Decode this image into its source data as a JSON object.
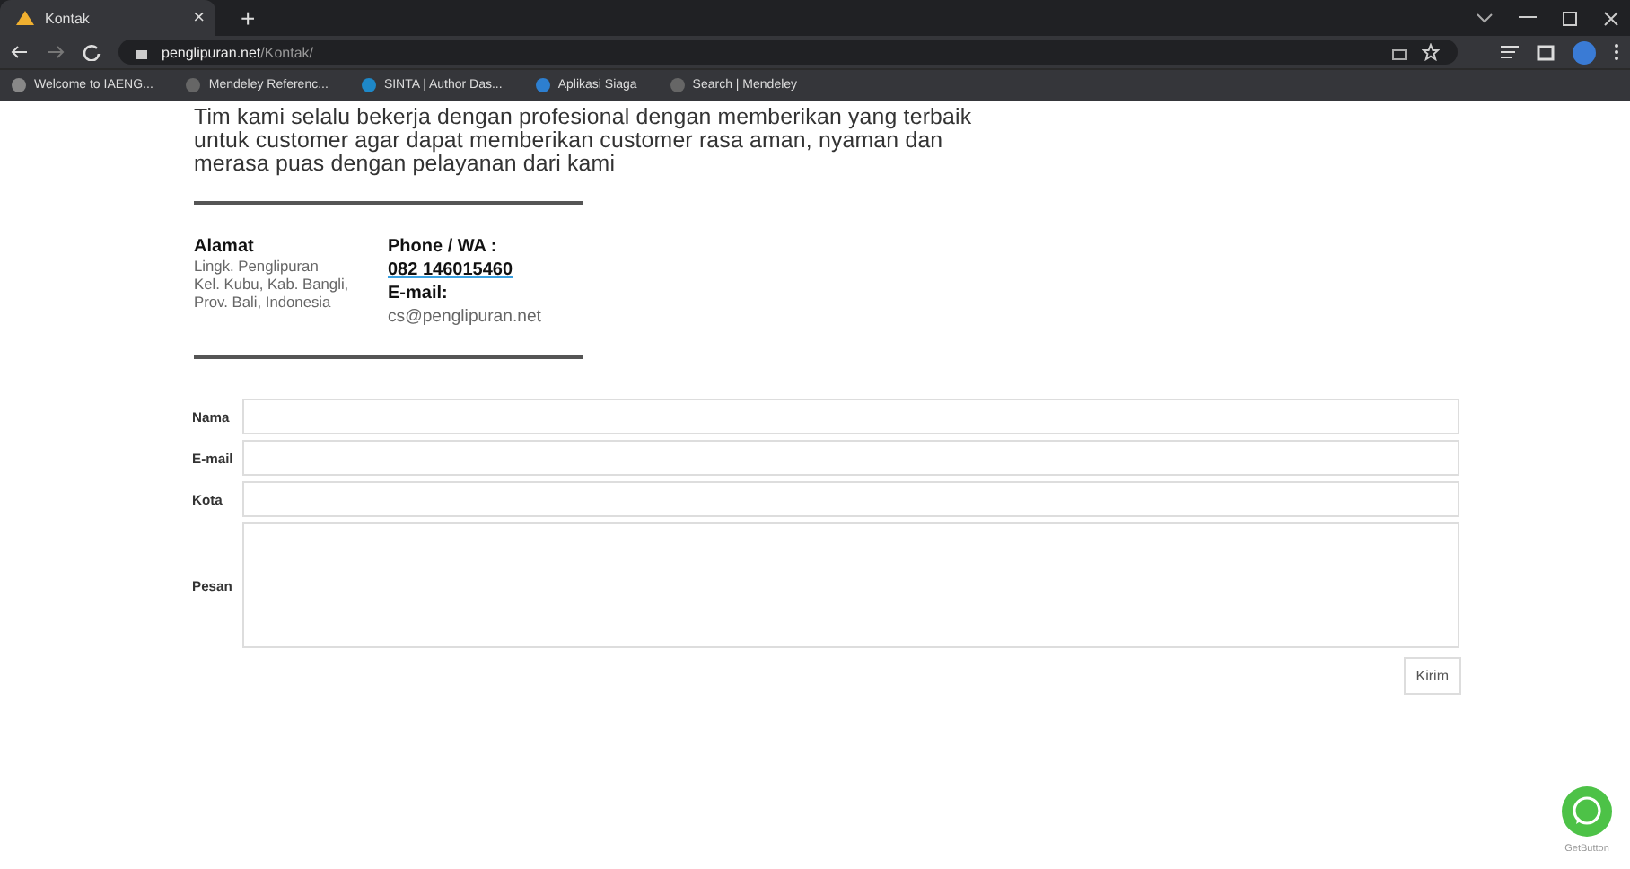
{
  "browser": {
    "tab": {
      "title": "Kontak",
      "close": "×",
      "new_tab": "+"
    },
    "address": {
      "domain": "penglipuran.net",
      "path": "/Kontak/"
    },
    "bookmarks": [
      {
        "label": "Welcome to IAENG..."
      },
      {
        "label": "Mendeley Referenc..."
      },
      {
        "label": "SINTA | Author Das..."
      },
      {
        "label": "Aplikasi Siaga"
      },
      {
        "label": "Search | Mendeley"
      }
    ]
  },
  "intro": [
    "Tim kami selalu bekerja dengan profesional dengan memberikan yang terbaik",
    "untuk customer agar dapat memberikan customer rasa aman, nyaman dan",
    "merasa puas dengan pelayanan dari kami"
  ],
  "contact": {
    "address_heading": "Alamat",
    "address_lines": [
      "Lingk. Penglipuran",
      "Kel. Kubu, Kab. Bangli,",
      "Prov. Bali, Indonesia"
    ],
    "phone_heading": "Phone / WA :",
    "phone": "082 146015460",
    "email_heading": "E-mail:",
    "email": "cs@penglipuran.net"
  },
  "form": {
    "fields": [
      {
        "label": "Nama",
        "kind": "line"
      },
      {
        "label": "E-mail",
        "kind": "line"
      },
      {
        "label": "Kota",
        "kind": "line"
      },
      {
        "label": "Pesan",
        "kind": "area"
      }
    ],
    "submit": "Kirim"
  },
  "widget": {
    "credit": "GetButton"
  }
}
